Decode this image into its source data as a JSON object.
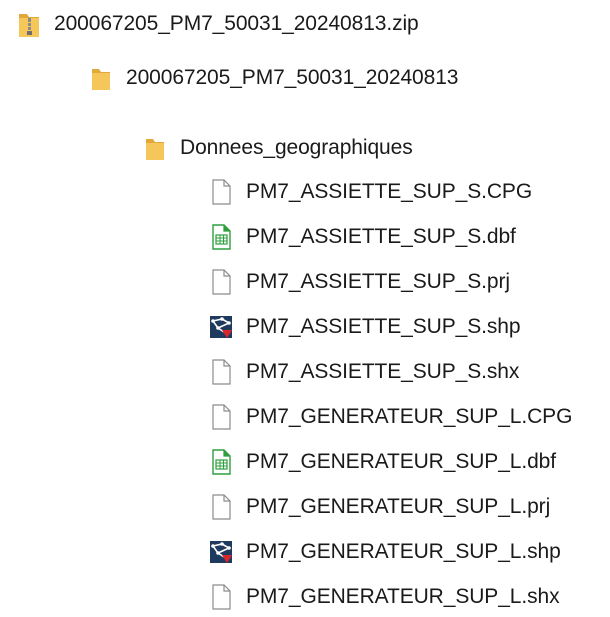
{
  "tree": {
    "zip": {
      "label": "200067205_PM7_50031_20240813.zip",
      "icon": "zip-folder-icon"
    },
    "folder": {
      "label": "200067205_PM7_50031_20240813",
      "icon": "folder-icon"
    },
    "subfolder": {
      "label": "Donnees_geographiques",
      "icon": "folder-icon"
    },
    "files": [
      {
        "label": "PM7_ASSIETTE_SUP_S.CPG",
        "icon": "blank-file-icon"
      },
      {
        "label": "PM7_ASSIETTE_SUP_S.dbf",
        "icon": "spreadsheet-file-icon"
      },
      {
        "label": "PM7_ASSIETTE_SUP_S.prj",
        "icon": "blank-file-icon"
      },
      {
        "label": "PM7_ASSIETTE_SUP_S.shp",
        "icon": "shapefile-icon"
      },
      {
        "label": "PM7_ASSIETTE_SUP_S.shx",
        "icon": "blank-file-icon"
      },
      {
        "label": "PM7_GENERATEUR_SUP_L.CPG",
        "icon": "blank-file-icon"
      },
      {
        "label": "PM7_GENERATEUR_SUP_L.dbf",
        "icon": "spreadsheet-file-icon"
      },
      {
        "label": "PM7_GENERATEUR_SUP_L.prj",
        "icon": "blank-file-icon"
      },
      {
        "label": "PM7_GENERATEUR_SUP_L.shp",
        "icon": "shapefile-icon"
      },
      {
        "label": "PM7_GENERATEUR_SUP_L.shx",
        "icon": "blank-file-icon"
      }
    ]
  },
  "colors": {
    "folder": "#F5C75B",
    "folder_dark": "#E0A93A",
    "zip_stripe": "#8A8A8A",
    "file_border": "#8C8C8C",
    "spreadsheet_green": "#2E9E3E",
    "shp_navy": "#1F3A5F",
    "shp_red": "#D9262C"
  }
}
